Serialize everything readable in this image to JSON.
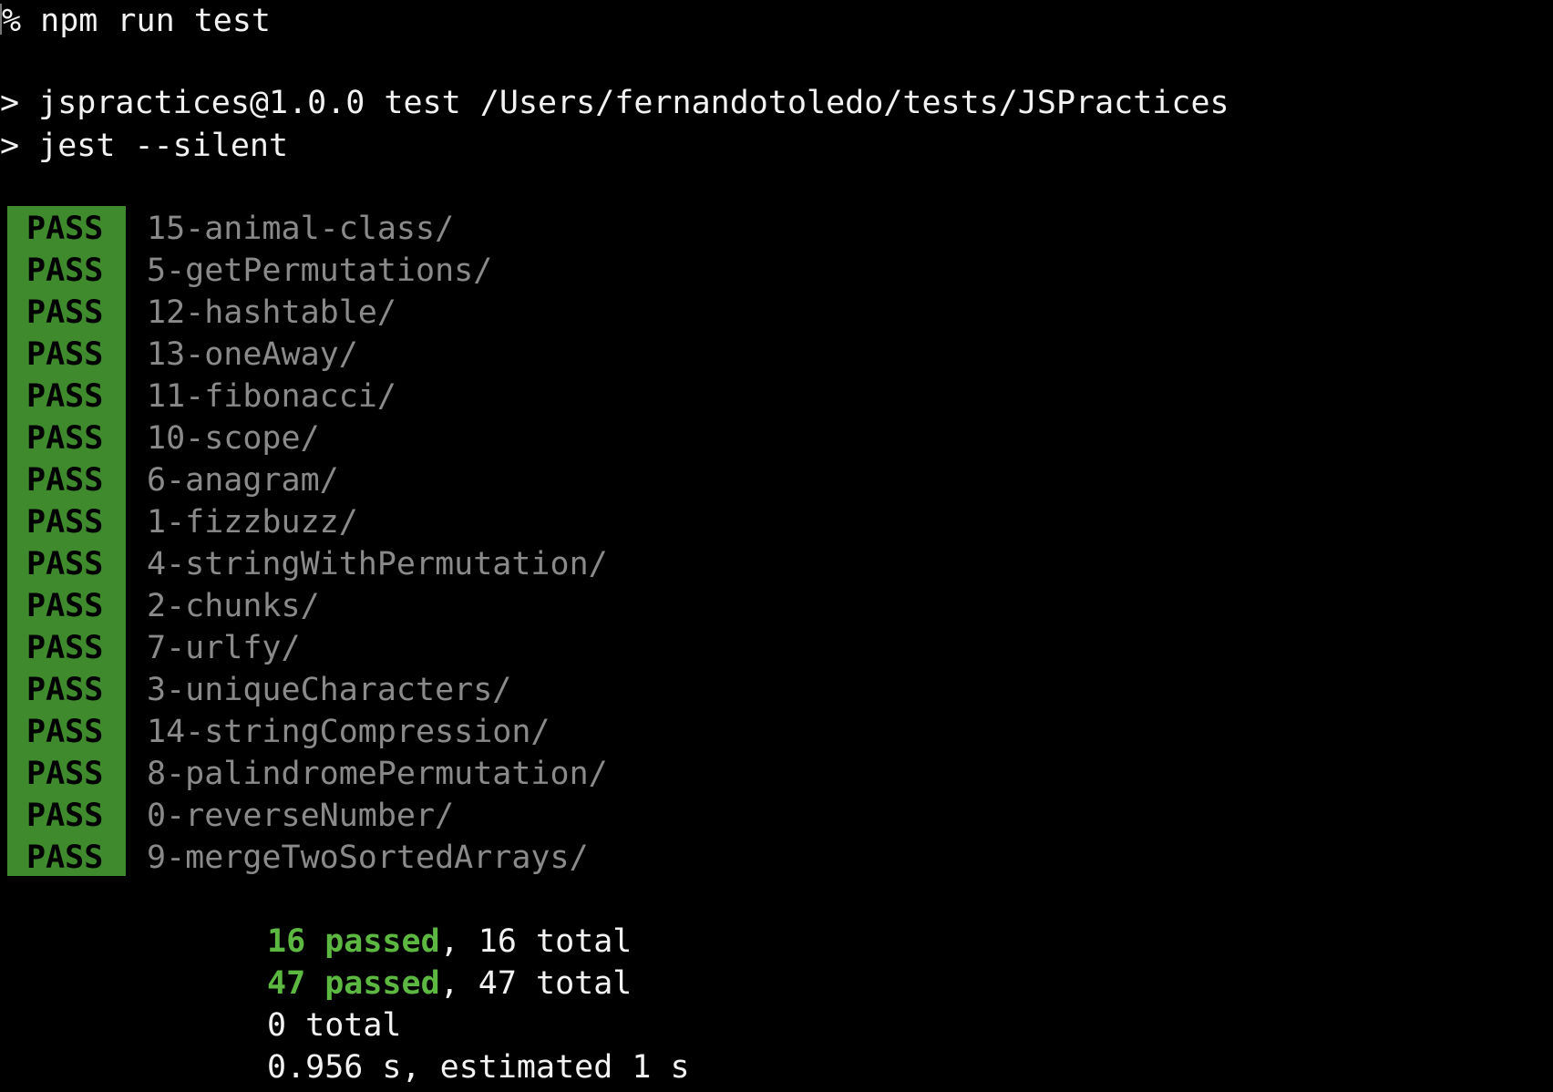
{
  "terminal": {
    "command_line": "% npm run test",
    "script_lines": [
      "> jspractices@1.0.0 test /Users/fernandotoledo/tests/JSPractices",
      "> jest --silent"
    ],
    "results": [
      {
        "status": "PASS",
        "path": "15-animal-class/"
      },
      {
        "status": "PASS",
        "path": "5-getPermutations/"
      },
      {
        "status": "PASS",
        "path": "12-hashtable/"
      },
      {
        "status": "PASS",
        "path": "13-oneAway/"
      },
      {
        "status": "PASS",
        "path": "11-fibonacci/"
      },
      {
        "status": "PASS",
        "path": "10-scope/"
      },
      {
        "status": "PASS",
        "path": "6-anagram/"
      },
      {
        "status": "PASS",
        "path": "1-fizzbuzz/"
      },
      {
        "status": "PASS",
        "path": "4-stringWithPermutation/"
      },
      {
        "status": "PASS",
        "path": "2-chunks/"
      },
      {
        "status": "PASS",
        "path": "7-urlfy/"
      },
      {
        "status": "PASS",
        "path": "3-uniqueCharacters/"
      },
      {
        "status": "PASS",
        "path": "14-stringCompression/"
      },
      {
        "status": "PASS",
        "path": "8-palindromePermutation/"
      },
      {
        "status": "PASS",
        "path": "0-reverseNumber/"
      },
      {
        "status": "PASS",
        "path": "9-mergeTwoSortedArrays/"
      }
    ],
    "summary": {
      "suites_passed": "16 passed",
      "suites_total": ", 16 total",
      "tests_passed": "47 passed",
      "tests_total": ", 47 total",
      "snapshots": "0 total",
      "time": "0.956 s, estimated 1 s"
    },
    "colors": {
      "pass_bg": "#3f8a2c",
      "passed_text": "#5cb840",
      "path_text": "#8a8a8a"
    }
  }
}
